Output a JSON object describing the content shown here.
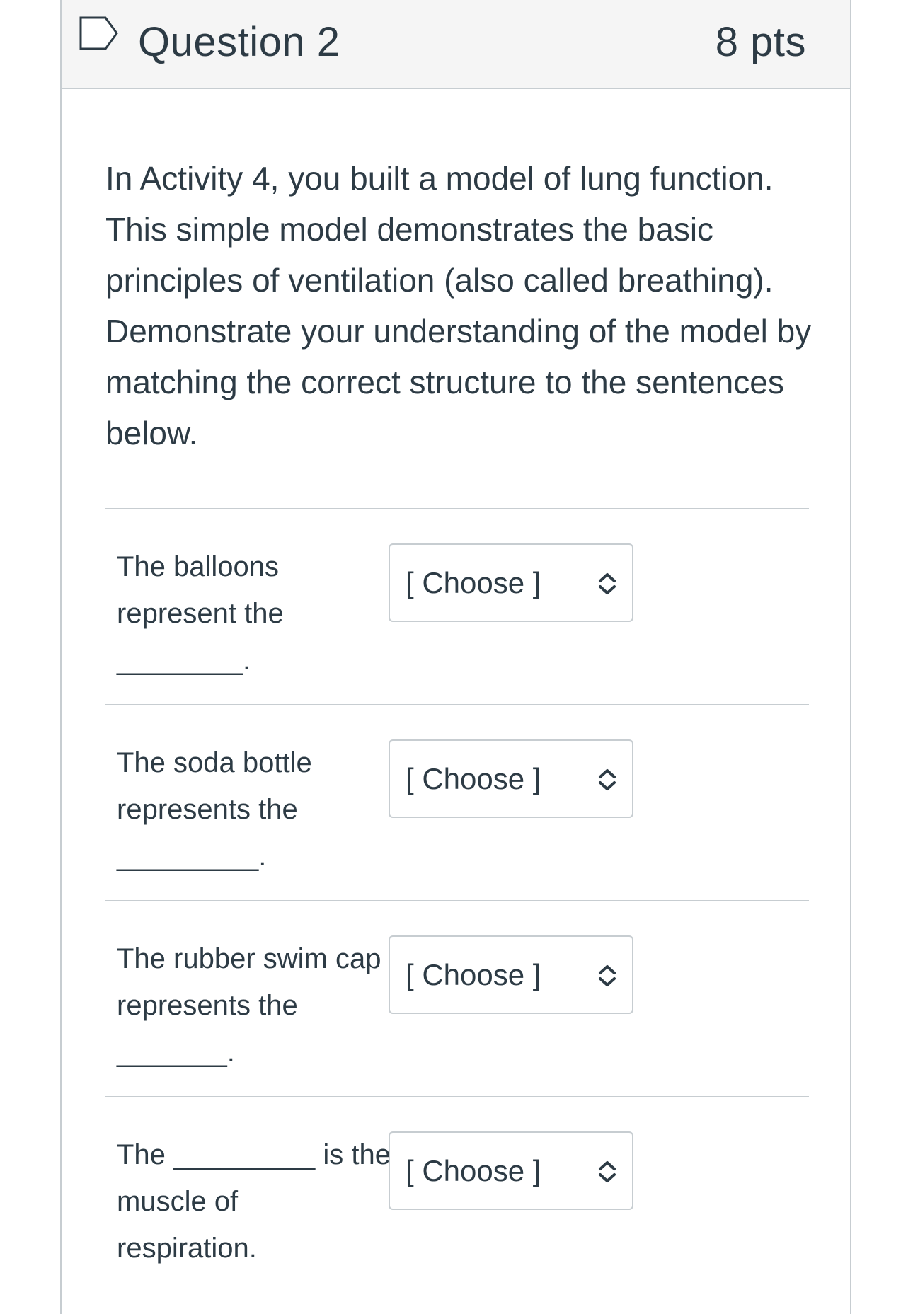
{
  "question": {
    "title": "Question 2",
    "points": "8 pts",
    "prompt": "In Activity 4, you built a model of lung function. This simple model demonstrates the basic principles of ventilation (also called breathing). Demonstrate your understanding of the model by matching the correct structure to the sentences below."
  },
  "answers": [
    {
      "line1": "The balloons",
      "line2": "represent the",
      "line3": "________.",
      "select": "[ Choose ]"
    },
    {
      "line1": "The soda bottle",
      "line2": "represents the",
      "line3": "_________.",
      "select": "[ Choose ]"
    },
    {
      "line1": "The rubber swim cap",
      "line2": "represents the",
      "line3": "_______.",
      "select": "[ Choose ]"
    },
    {
      "line1": "The _________ is the",
      "line2": "muscle of",
      "line3": "respiration.",
      "select": "[ Choose ]"
    }
  ],
  "icons": {
    "flag": "bookmark-flag-icon",
    "select_arrows": "chevron-up-down-icon"
  },
  "colors": {
    "text": "#2d3b45",
    "border": "#c7cdd1",
    "header_bg": "#f5f5f5"
  }
}
